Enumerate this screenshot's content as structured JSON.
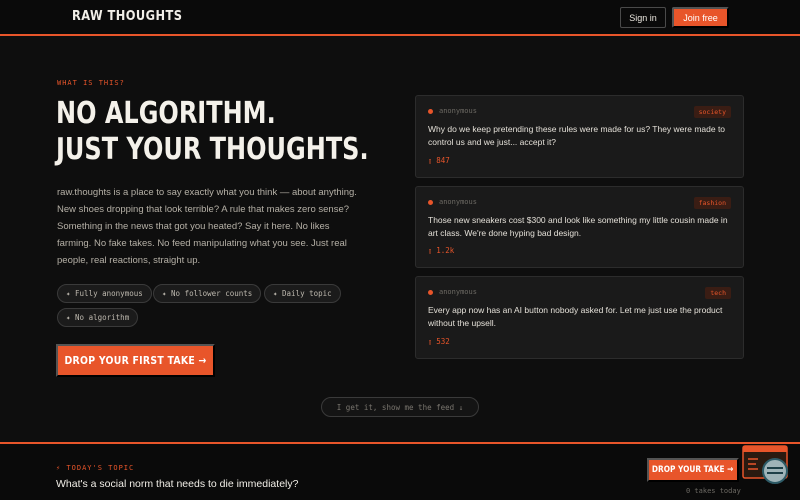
{
  "header": {
    "brand": "RAW THOUGHTS",
    "signin_label": "Sign in",
    "join_label": "Join free"
  },
  "hero": {
    "eyebrow": "WHAT IS THIS?",
    "title_line1": "NO ALGORITHM.",
    "title_line2": "JUST YOUR THOUGHTS.",
    "description": "raw.thoughts is a place to say exactly what you think — about anything. New shoes dropping that look terrible? A rule that makes zero sense? Something in the news that got you heated? Say it here. No likes farming. No fake takes. No feed manipulating what you see. Just real people, real reactions, straight up.",
    "chips": [
      "✦ Fully anonymous",
      "✦ No follower counts",
      "✦ Daily topic",
      "✦ No algorithm"
    ],
    "cta_label": "DROP YOUR FIRST TAKE →"
  },
  "cards": [
    {
      "author": "anonymous",
      "tag": "society",
      "text": "Why do we keep pretending these rules were made for us? They were made to control us and we just... accept it?",
      "reactions": "847"
    },
    {
      "author": "anonymous",
      "tag": "fashion",
      "text": "Those new sneakers cost $300 and look like something my little cousin made in art class. We're done hyping bad design.",
      "reactions": "1.2k"
    },
    {
      "author": "anonymous",
      "tag": "tech",
      "text": "Every app now has an AI button nobody asked for. Let me just use the product without the upsell.",
      "reactions": "532"
    }
  ],
  "feed_link_label": "I get it, show me the feed ↓",
  "today": {
    "eyebrow": "⚡ TODAY'S TOPIC",
    "question": "What's a social norm that needs to die immediately?",
    "cta_label": "DROP YOUR TAKE →",
    "takes_count": "0 takes today"
  },
  "colors": {
    "accent": "#e8552a",
    "background": "#0e0e0e",
    "card": "#1a1a1a"
  }
}
